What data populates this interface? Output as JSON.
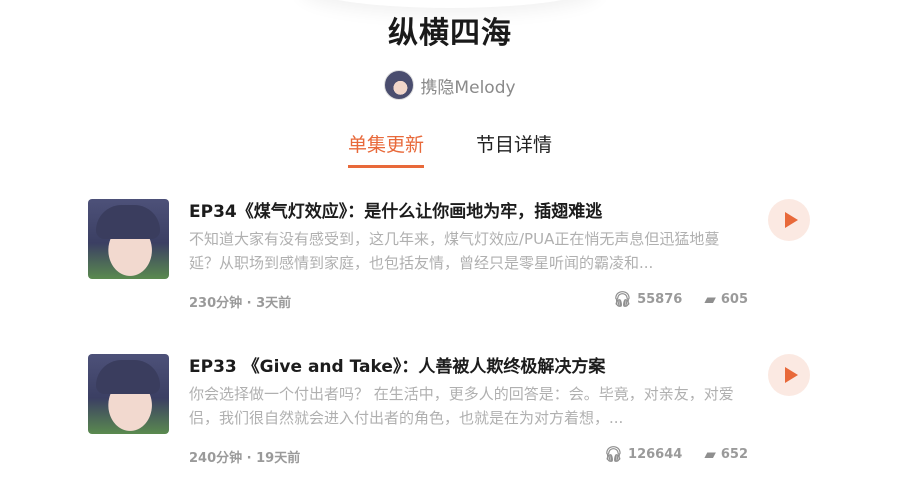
{
  "podcast": {
    "title": "纵横四海",
    "author": "携隐Melody"
  },
  "tabs": [
    {
      "label": "单集更新",
      "active": true
    },
    {
      "label": "节目详情",
      "active": false
    }
  ],
  "accent_color": "#e8693a",
  "episodes": [
    {
      "title": "EP34《煤气灯效应》：是什么让你画地为牢，插翅难逃",
      "description": "不知道大家有没有感受到，这几年来，煤气灯效应/PUA正在悄无声息但迅猛地蔓延？从职场到感情到家庭，也包括友情，曾经只是零星听闻的霸凌和...",
      "meta": "230分钟 · 3天前",
      "plays": "55876",
      "comments": "605"
    },
    {
      "title": "EP33 《Give and Take》：人善被人欺终极解决方案",
      "description": "你会选择做一个付出者吗？ 在生活中，更多人的回答是：会。毕竟，对亲友，对爱侣，我们很自然就会进入付出者的角色，也就是在为对方着想，...",
      "meta": "240分钟 · 19天前",
      "plays": "126644",
      "comments": "652"
    }
  ],
  "icons": {
    "plays": "headphones-icon",
    "comments": "comment-icon",
    "play": "play-icon"
  }
}
